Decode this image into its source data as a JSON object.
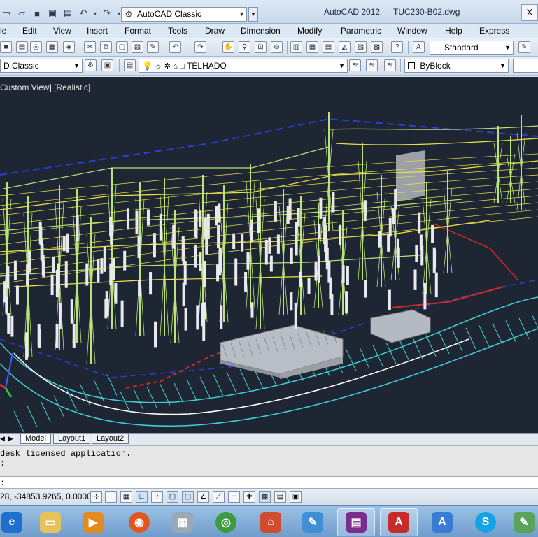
{
  "titlebar": {
    "workspace": "AutoCAD Classic",
    "app_title": "AutoCAD 2012",
    "file_title": "TUC230-B02.dwg",
    "close_symbol": "X"
  },
  "menu": [
    "le",
    "Edit",
    "View",
    "Insert",
    "Format",
    "Tools",
    "Draw",
    "Dimension",
    "Modify",
    "Parametric",
    "Window",
    "Help",
    "Express"
  ],
  "toolbar1": {
    "text_style": "Standard"
  },
  "toolbar2": {
    "workspace_combo": "D Classic",
    "layer": "TELHADO",
    "color": "ByBlock"
  },
  "viewport": {
    "label": "Custom View] [Realistic]"
  },
  "tabs": [
    "Model",
    "Layout1",
    "Layout2"
  ],
  "command": {
    "line1": "desk licensed application.",
    "line2": ":",
    "prompt": ":"
  },
  "status": {
    "coords": "28, -34853.9265, 0.0000"
  },
  "taskbar_icons": [
    "ie-icon",
    "explorer-icon",
    "media-player-icon",
    "firefox-icon",
    "calculator-icon",
    "chrome-icon",
    "usb-icon",
    "paint-icon",
    "winrar-icon",
    "autocad-icon",
    "wordpad-icon",
    "skype-icon",
    "paint2-icon"
  ],
  "colors": {
    "canvas_bg": "#1f2633",
    "structure_yellow": "#e8e24a",
    "structure_green": "#b9e27a",
    "road_cyan": "#3fd0d6",
    "line_blue": "#2a3fd6",
    "line_red": "#d22a2a"
  }
}
